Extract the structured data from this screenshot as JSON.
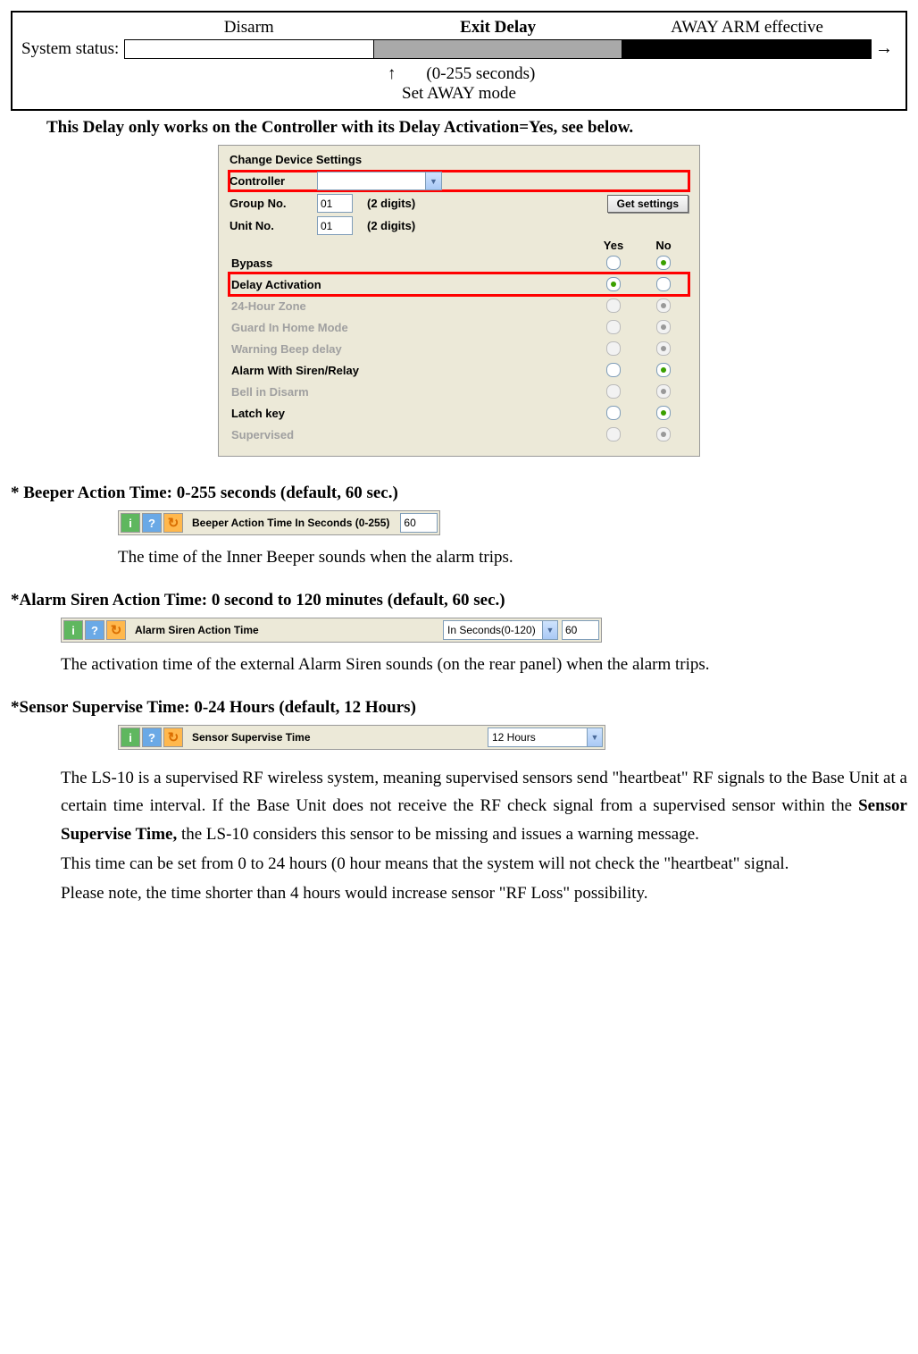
{
  "status": {
    "label": "System status:",
    "col1": "Disarm",
    "col2": "Exit Delay",
    "col3": "AWAY ARM effective",
    "arrow": "→",
    "row2_arrow": "↑",
    "row2_range": "(0-255 seconds)",
    "row3": "Set AWAY mode"
  },
  "note_bold": "This Delay only works on the Controller with its Delay Activation=Yes, see below.",
  "settings": {
    "title": "Change Device Settings",
    "controller_lbl": "Controller",
    "group_lbl": "Group No.",
    "group_val": "01",
    "unit_lbl": "Unit No.",
    "unit_val": "01",
    "digits": "(2 digits)",
    "getbtn": "Get settings",
    "yes": "Yes",
    "no": "No",
    "rows": [
      {
        "label": "Bypass",
        "yes": false,
        "no": true,
        "disabled": false,
        "hl": false
      },
      {
        "label": "Delay Activation",
        "yes": true,
        "no": false,
        "disabled": false,
        "hl": true
      },
      {
        "label": "24-Hour Zone",
        "yes": false,
        "no": true,
        "disabled": true,
        "hl": false
      },
      {
        "label": "Guard In Home Mode",
        "yes": false,
        "no": true,
        "disabled": true,
        "hl": false
      },
      {
        "label": "Warning Beep delay",
        "yes": false,
        "no": true,
        "disabled": true,
        "hl": false
      },
      {
        "label": "Alarm With Siren/Relay",
        "yes": false,
        "no": true,
        "disabled": false,
        "hl": false
      },
      {
        "label": "Bell in Disarm",
        "yes": false,
        "no": true,
        "disabled": true,
        "hl": false
      },
      {
        "label": "Latch key",
        "yes": false,
        "no": true,
        "disabled": false,
        "hl": false
      },
      {
        "label": "Supervised",
        "yes": false,
        "no": true,
        "disabled": true,
        "hl": false
      }
    ]
  },
  "beeper": {
    "heading": "* Beeper Action Time: 0-255 seconds (default, 60 sec.)",
    "label": "Beeper Action Time In Seconds (0-255)",
    "value": "60",
    "desc": "The time of the Inner Beeper sounds when the alarm trips."
  },
  "siren": {
    "heading": "*Alarm Siren Action Time: 0 second to 120 minutes (default, 60 sec.)",
    "label": "Alarm Siren Action Time",
    "dd": "In Seconds(0-120)",
    "value": "60",
    "desc": "The activation time of the external Alarm Siren sounds (on the rear panel) when the alarm trips."
  },
  "supervise": {
    "heading": "*Sensor Supervise Time: 0-24 Hours (default, 12 Hours)",
    "label": "Sensor Supervise Time",
    "dd": "12 Hours",
    "p1a": "The LS-10 is a supervised RF wireless system, meaning supervised sensors send \"heartbeat\" RF signals to the Base Unit at a certain time interval. If the Base Unit does not receive the RF check signal from a supervised sensor within the ",
    "p1b": "Sensor Supervise Time,",
    "p1c": " the LS-10 considers this sensor to be missing and issues a warning message.",
    "p2": "This time can be set from 0 to 24 hours (0 hour means that the system will not check the \"heartbeat\" signal.",
    "p3": "Please note, the time shorter than 4 hours would increase sensor \"RF Loss\" possibility."
  }
}
